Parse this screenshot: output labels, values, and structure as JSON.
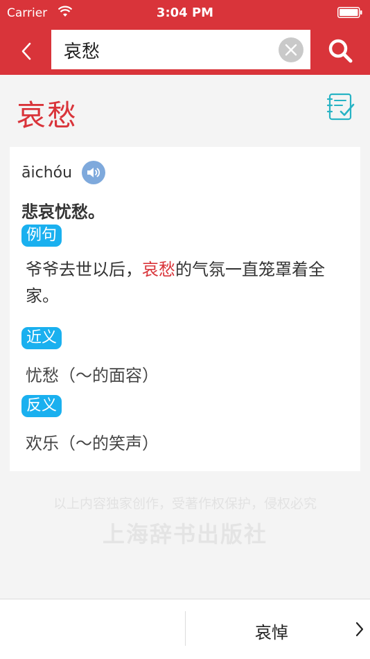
{
  "status_bar": {
    "carrier": "Carrier",
    "time": "3:04 PM",
    "wifi_icon": "wifi-icon",
    "battery_icon": "battery-icon"
  },
  "search": {
    "value": "哀愁",
    "back_icon": "chevron-left-icon",
    "clear_icon": "clear-icon",
    "search_icon": "search-icon"
  },
  "entry": {
    "headword": "哀愁",
    "notebook_icon": "notebook-check-icon",
    "pinyin": "āichóu",
    "speaker_icon": "speaker-icon",
    "definition": "悲哀忧愁。",
    "example_tag": "例句",
    "example_before": "爷爷去世以后，",
    "example_highlight": "哀愁",
    "example_after": "的气氛一直笼罩着全家。",
    "synonym_tag": "近义",
    "synonym": "忧愁（～的面容）",
    "antonym_tag": "反义",
    "antonym": "欢乐（～的笑声）"
  },
  "copyright": {
    "notice": "以上内容独家创作，受著作权保护，侵权必究",
    "publisher": "上海辞书出版社"
  },
  "bottom_nav": {
    "next_label": "哀悼",
    "next_icon": "chevron-right-icon"
  },
  "colors": {
    "brand_red": "#d9343a",
    "tag_blue": "#1ab0ef",
    "speaker_blue": "#7ea9dc",
    "notebook_teal": "#27b3c4"
  }
}
